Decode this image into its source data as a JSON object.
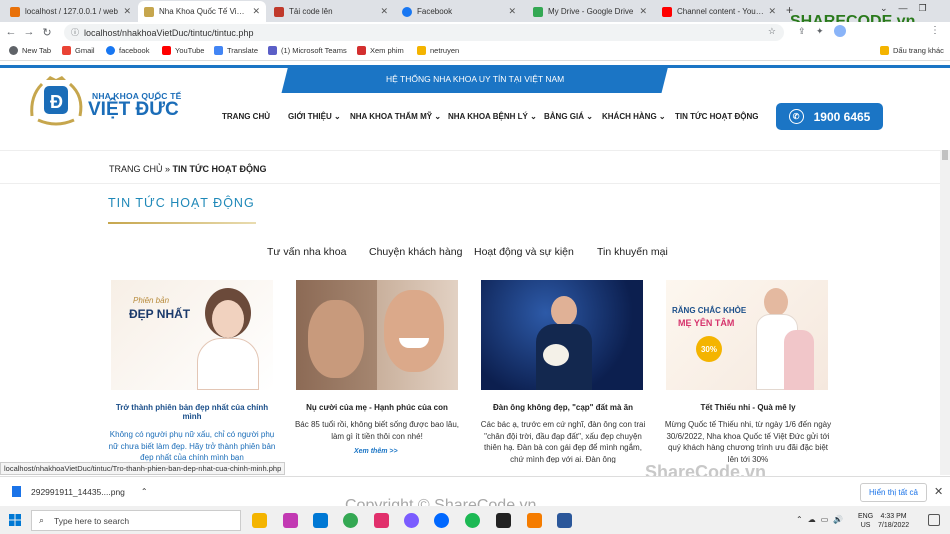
{
  "browser": {
    "tabs": [
      {
        "label": "localhost / 127.0.0.1 / web",
        "color": "#e8710a"
      },
      {
        "label": "Nha Khoa Quốc Tế Việt Đức",
        "color": "#c6a64d",
        "active": true
      },
      {
        "label": "Tải code lên",
        "color": "#c0392b"
      },
      {
        "label": "Facebook",
        "color": "#1877f2"
      },
      {
        "label": "My Drive - Google Drive",
        "color": "#34a853"
      },
      {
        "label": "Channel content - YouTube",
        "color": "#ff0000"
      }
    ],
    "url": "localhost/nhakhoaVietDuc/tintuc/tintuc.php",
    "bookmarks": [
      "New Tab",
      "Gmail",
      "facebook",
      "YouTube",
      "Translate",
      "(1) Microsoft Teams",
      "Xem phim",
      "netruyen"
    ],
    "bookmarks_right": "Dấu trang khác",
    "status_url": "localhost/nhakhoaVietDuc/tintuc/Tro-thanh-phien-ban-dep-nhat-cua-chinh-minh.php"
  },
  "site": {
    "banner": "HỆ THỐNG NHA KHOA UY TÍN TẠI VIỆT NAM",
    "logo_line1": "NHA KHOA QUỐC TẾ",
    "logo_line2": "VIỆT ĐỨC",
    "menu": [
      "TRANG CHỦ",
      "GIỚI THIỆU",
      "NHA KHOA THẨM MỸ",
      "NHA KHOA BỆNH LÝ",
      "BẢNG GIÁ",
      "KHÁCH HÀNG",
      "TIN TỨC HOẠT ĐỘNG"
    ],
    "phone": "1900 6465",
    "breadcrumb_home": "TRANG CHỦ",
    "breadcrumb_sep": "»",
    "breadcrumb_current": "TIN TỨC HOẠT ĐỘNG",
    "page_title": "TIN TỨC HOẠT ĐỘNG",
    "categories": [
      "Tư vấn nha khoa",
      "Chuyện khách hàng",
      "Hoạt động và sự kiện",
      "Tin khuyến mại"
    ],
    "cards": [
      {
        "title": "Trở thành phiên bản đẹp nhất của chính mình",
        "desc": "Không có người phụ nữ xấu, chỉ có người phụ nữ chưa biết làm đẹp. Hãy trở thành phiên bản đẹp nhất của chính mình bạn",
        "img_text1": "Phiên bản",
        "img_text2": "ĐẸP NHẤT"
      },
      {
        "title": "Nụ cười của mẹ - Hạnh phúc của con",
        "desc": "Bác 85 tuổi rồi, không biết sống được bao lâu, làm gì ít tiền thôi con nhé!",
        "more": "Xem thêm >>"
      },
      {
        "title": "Đàn ông không đẹp, \"cạp\" đất mà ăn",
        "desc": "Các bác ạ, trước em cứ nghĩ, đàn ông con trai \"chân đội trời, đầu đạp đất\", xấu đẹp chuyện thiên hạ. Đàn bà con gái đẹp để mình ngắm, chứ mình đẹp với ai. Đàn ông"
      },
      {
        "title": "Tết Thiếu nhi - Quà mê ly",
        "desc": "Mừng Quốc tế Thiếu nhi, từ ngày 1/6 đến ngày 30/6/2022, Nha khoa Quốc tế Việt Đức gửi tới quý khách hàng chương trình ưu đãi đặc biệt lên tới 30%",
        "img_text1": "RĂNG CHẮC KHỎE",
        "img_text2": "MẸ YÊN TÂM",
        "img_badge": "30%"
      }
    ]
  },
  "download": {
    "file": "292991911_14435....png",
    "show_all": "Hiển thị tất cả"
  },
  "taskbar": {
    "search": "Type here to search",
    "time": "4:33 PM",
    "date": "7/18/2022",
    "lang1": "ENG",
    "lang2": "US"
  },
  "watermark": {
    "logo": "SHARECODE.vn",
    "logo2": "ShareCode.vn",
    "copyright": "Copyright © ShareCode.vn"
  }
}
